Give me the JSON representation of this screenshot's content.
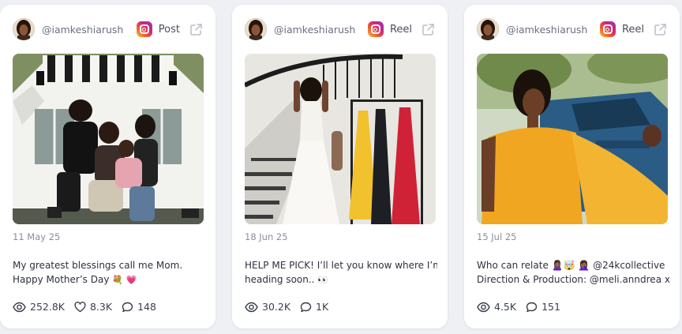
{
  "cards": [
    {
      "handle": "@iamkeshiarush",
      "post_type": "Post",
      "platform_icon": "instagram-icon",
      "date": "11 May 25",
      "caption_line1": "My greatest blessings call me Mom.",
      "caption_line2": "Happy Mother’s Day",
      "caption_emojis": "💐 💗",
      "stats": {
        "views": "252.8K",
        "likes": "8.3K",
        "comments": "148"
      }
    },
    {
      "handle": "@iamkeshiarush",
      "post_type": "Reel",
      "platform_icon": "instagram-icon",
      "date": "18 Jun 25",
      "caption_line1": "HELP ME PICK! I’ll let you know where I’m",
      "caption_line2": "heading soon..",
      "caption_emojis": "👀",
      "stats": {
        "views": "30.2K",
        "comments": "1K"
      }
    },
    {
      "handle": "@iamkeshiarush",
      "post_type": "Reel",
      "platform_icon": "instagram-icon",
      "date": "15 Jul 25",
      "caption_line1": "Who can relate 🙎🏾‍♀️🤯 🤦🏾‍♀️ @24kcollective",
      "caption_line2": "Direction & Production: @meli.anndrea x...",
      "caption_emojis": "",
      "stats": {
        "views": "4.5K",
        "comments": "151"
      }
    }
  ],
  "colors": {
    "page_bg": "#eef0f4",
    "card_bg": "#ffffff",
    "muted_text": "#8a8f9c",
    "instagram_gradient": [
      "#f9c94a",
      "#f0662c",
      "#d6286c",
      "#8c36c8"
    ]
  }
}
